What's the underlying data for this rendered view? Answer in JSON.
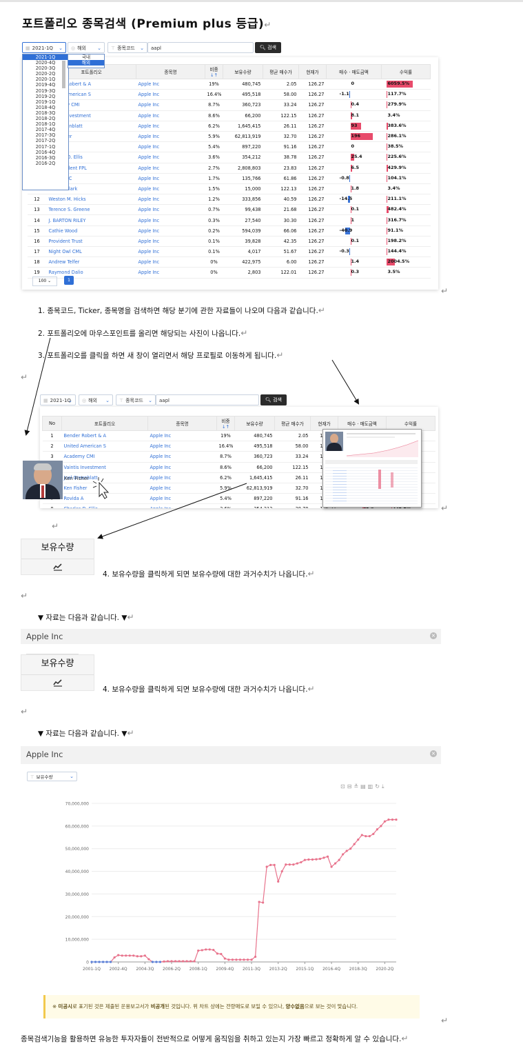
{
  "title": "포트폴리오 종목검색 (Premium plus 등급)",
  "return_mark": "↵",
  "filters": {
    "quarter": "2021-1Q",
    "region": "해외",
    "field": "종목코드",
    "query": "aapl",
    "search_label": "검색"
  },
  "quarter_options": [
    "2021-1Q",
    "2020-4Q",
    "2020-3Q",
    "2020-2Q",
    "2020-1Q",
    "2019-4Q",
    "2019-3Q",
    "2019-2Q",
    "2019-1Q",
    "2018-4Q",
    "2018-3Q",
    "2018-2Q",
    "2018-1Q",
    "2017-4Q",
    "2017-3Q",
    "2017-2Q",
    "2017-1Q",
    "2016-4Q",
    "2016-3Q",
    "2016-2Q"
  ],
  "region_options": [
    "국내",
    "해외"
  ],
  "table": {
    "headers": [
      "No",
      "포트폴리오",
      "종목명",
      "비중",
      "보유수량",
      "평균 매수가",
      "현재가",
      "매수 · 매도금액",
      "수익률"
    ],
    "header_sort_icon": "↓↑",
    "rows": [
      {
        "no": "1",
        "portfolio": "Bender Robert & A",
        "stock": "Apple Inc",
        "weight": "19%",
        "qty": "480,745",
        "avg": "2.05",
        "price": "126.27",
        "trade": "0",
        "ret": "6059.5%"
      },
      {
        "no": "2",
        "portfolio": "United American S",
        "stock": "Apple Inc",
        "weight": "16.4%",
        "qty": "495,518",
        "avg": "58.00",
        "price": "126.27",
        "trade": "-1.1",
        "ret": "117.7%"
      },
      {
        "no": "3",
        "portfolio": "Academy CMI",
        "stock": "Apple Inc",
        "weight": "8.7%",
        "qty": "360,723",
        "avg": "33.24",
        "price": "126.27",
        "trade": "0.4",
        "ret": "279.9%"
      },
      {
        "no": "4",
        "portfolio": "Vaintis Investment",
        "stock": "Apple Inc",
        "weight": "8.6%",
        "qty": "66,200",
        "avg": "122.15",
        "price": "126.27",
        "trade": "8.1",
        "ret": "3.4%"
      },
      {
        "no": "5",
        "portfolio": "Joel Greenblatt",
        "stock": "Apple Inc",
        "weight": "6.2%",
        "qty": "1,645,415",
        "avg": "26.11",
        "price": "126.27",
        "trade": "93",
        "ret": "383.6%"
      },
      {
        "no": "6",
        "portfolio": "Ken Fisher",
        "stock": "Apple Inc",
        "weight": "5.9%",
        "qty": "62,813,919",
        "avg": "32.70",
        "price": "126.27",
        "trade": "196",
        "ret": "286.1%"
      },
      {
        "no": "7",
        "portfolio": "Rovida A",
        "stock": "Apple Inc",
        "weight": "5.4%",
        "qty": "897,220",
        "avg": "91.16",
        "price": "126.27",
        "trade": "0",
        "ret": "38.5%"
      },
      {
        "no": "8",
        "portfolio": "Charles D. Ellis",
        "stock": "Apple Inc",
        "weight": "3.6%",
        "qty": "354,212",
        "avg": "38.78",
        "price": "126.27",
        "trade": "25.4",
        "ret": "225.6%"
      },
      {
        "no": "9",
        "portfolio": "Independent FPL",
        "stock": "Apple Inc",
        "weight": "2.7%",
        "qty": "2,808,803",
        "avg": "23.83",
        "price": "126.27",
        "trade": "6.5",
        "ret": "429.9%"
      },
      {
        "no": "10",
        "portfolio": "Horst FMC",
        "stock": "Apple Inc",
        "weight": "1.7%",
        "qty": "135,766",
        "avg": "61.86",
        "price": "126.27",
        "trade": "-0.8",
        "ret": "104.1%"
      },
      {
        "no": "11",
        "portfolio": "Willard Clark",
        "stock": "Apple Inc",
        "weight": "1.5%",
        "qty": "15,000",
        "avg": "122.13",
        "price": "126.27",
        "trade": "1.8",
        "ret": "3.4%"
      },
      {
        "no": "12",
        "portfolio": "Weston M. Hicks",
        "stock": "Apple Inc",
        "weight": "1.2%",
        "qty": "333,856",
        "avg": "40.59",
        "price": "126.27",
        "trade": "-14.5",
        "ret": "211.1%"
      },
      {
        "no": "13",
        "portfolio": "Terence S. Greene",
        "stock": "Apple Inc",
        "weight": "0.7%",
        "qty": "99,438",
        "avg": "21.68",
        "price": "126.27",
        "trade": "0.1",
        "ret": "482.4%"
      },
      {
        "no": "14",
        "portfolio": "J. BARTON RILEY",
        "stock": "Apple Inc",
        "weight": "0.3%",
        "qty": "27,540",
        "avg": "30.30",
        "price": "126.27",
        "trade": "1",
        "ret": "316.7%"
      },
      {
        "no": "15",
        "portfolio": "Cathie Wood",
        "stock": "Apple Inc",
        "weight": "0.2%",
        "qty": "594,039",
        "avg": "66.06",
        "price": "126.27",
        "trade": "-40.9",
        "ret": "91.1%"
      },
      {
        "no": "16",
        "portfolio": "Provident Trust",
        "stock": "Apple Inc",
        "weight": "0.1%",
        "qty": "39,828",
        "avg": "42.35",
        "price": "126.27",
        "trade": "0.1",
        "ret": "198.2%"
      },
      {
        "no": "17",
        "portfolio": "Night Owl CML",
        "stock": "Apple Inc",
        "weight": "0.1%",
        "qty": "4,017",
        "avg": "51.67",
        "price": "126.27",
        "trade": "-0.3",
        "ret": "144.4%"
      },
      {
        "no": "18",
        "portfolio": "Andrew Telfer",
        "stock": "Apple Inc",
        "weight": "0%",
        "qty": "422,975",
        "avg": "6.00",
        "price": "126.27",
        "trade": "1.4",
        "ret": "2004.5%"
      },
      {
        "no": "19",
        "portfolio": "Raymond Dalio",
        "stock": "Apple Inc",
        "weight": "0%",
        "qty": "2,803",
        "avg": "122.01",
        "price": "126.27",
        "trade": "0.3",
        "ret": "3.5%"
      }
    ]
  },
  "pagination": {
    "page_size": "100",
    "current_page": "1"
  },
  "steps": [
    "1.  종목코드, Ticker, 종목명을 검색하면 해당 분기에 관한 자료들이 나오며 다음과 같습니다.",
    "2.  포트폴리오에 마우스포인트를 올리면 해당되는 사진이 나옵니다.",
    "3.  포트폴리오를 클릭을 하면 새 창이 열리면서 해당 프로필로 이동하게 됩니다.",
    "4. 보유수량을 클릭하게 되면 보유수량에 대한 과거수치가 나옵니다."
  ],
  "hover_name": "Ken Fisher",
  "qty_header_label": "보유수량",
  "data_intro": "▼  자료는 다음과 같습니다. ▼",
  "modal": {
    "title": "Apple Inc",
    "metric": "보유수량"
  },
  "chart_data": {
    "type": "line",
    "title": "",
    "xlabel": "",
    "ylabel": "",
    "ylim": [
      0,
      70000000
    ],
    "yticks": [
      "0",
      "10,000,000",
      "20,000,000",
      "30,000,000",
      "40,000,000",
      "50,000,000",
      "60,000,000",
      "70,000,000"
    ],
    "xticks": [
      "2001-1Q",
      "2002-4Q",
      "2004-3Q",
      "2006-2Q",
      "2008-1Q",
      "2009-4Q",
      "2011-3Q",
      "2013-2Q",
      "2015-1Q",
      "2016-4Q",
      "2018-3Q",
      "2020-2Q"
    ],
    "line_color": "#e8738c",
    "zero_color": "#5b7fd6",
    "x": [
      "2001-1Q",
      "2001-2Q",
      "2001-3Q",
      "2001-4Q",
      "2002-1Q",
      "2002-2Q",
      "2002-3Q",
      "2002-4Q",
      "2003-1Q",
      "2003-2Q",
      "2003-3Q",
      "2003-4Q",
      "2004-1Q",
      "2004-2Q",
      "2004-3Q",
      "2004-4Q",
      "2005-1Q",
      "2005-2Q",
      "2005-3Q",
      "2005-4Q",
      "2006-1Q",
      "2006-2Q",
      "2006-3Q",
      "2006-4Q",
      "2007-1Q",
      "2007-2Q",
      "2007-3Q",
      "2007-4Q",
      "2008-1Q",
      "2008-2Q",
      "2008-3Q",
      "2008-4Q",
      "2009-1Q",
      "2009-2Q",
      "2009-3Q",
      "2009-4Q",
      "2010-1Q",
      "2010-2Q",
      "2010-3Q",
      "2010-4Q",
      "2011-1Q",
      "2011-2Q",
      "2011-3Q",
      "2011-4Q",
      "2012-1Q",
      "2012-2Q",
      "2012-3Q",
      "2012-4Q",
      "2013-1Q",
      "2013-2Q",
      "2013-3Q",
      "2013-4Q",
      "2014-1Q",
      "2014-2Q",
      "2014-3Q",
      "2014-4Q",
      "2015-1Q",
      "2015-2Q",
      "2015-3Q",
      "2015-4Q",
      "2016-1Q",
      "2016-2Q",
      "2016-3Q",
      "2016-4Q",
      "2017-1Q",
      "2017-2Q",
      "2017-3Q",
      "2017-4Q",
      "2018-1Q",
      "2018-2Q",
      "2018-3Q",
      "2018-4Q",
      "2019-1Q",
      "2019-2Q",
      "2019-3Q",
      "2019-4Q",
      "2020-1Q",
      "2020-2Q",
      "2020-3Q",
      "2020-4Q",
      "2021-1Q"
    ],
    "values": [
      0,
      0,
      0,
      0,
      0,
      0,
      2000000,
      3000000,
      2800000,
      2800000,
      2800000,
      2800000,
      2500000,
      2500000,
      2800000,
      1200000,
      0,
      0,
      0,
      200000,
      300000,
      300000,
      300000,
      300000,
      300000,
      300000,
      300000,
      300000,
      5000000,
      5200000,
      5500000,
      5500000,
      5300000,
      3700000,
      3500000,
      1500000,
      1000000,
      1000000,
      1000000,
      1000000,
      1000000,
      1000000,
      1000000,
      2300000,
      26500000,
      26200000,
      42000000,
      42800000,
      42800000,
      35500000,
      40000000,
      43000000,
      43000000,
      43000000,
      43500000,
      44000000,
      45000000,
      45200000,
      45200000,
      45300000,
      45500000,
      46000000,
      46500000,
      42000000,
      43500000,
      45000000,
      47500000,
      49000000,
      50000000,
      52000000,
      54000000,
      56000000,
      55500000,
      55500000,
      56500000,
      58500000,
      60000000,
      62000000,
      62800000,
      62813919,
      62813919
    ]
  },
  "note_parts": [
    "※ ",
    "미공시",
    "로 표기된 것은 제출된 운용보고서가 ",
    "비공개",
    "된 것입니다. 위 차트 상에는 전량매도로 보일 수 있으나, ",
    "양수없음",
    "으로 보는 것이 맞습니다."
  ],
  "conclusion": "종목검색기능을 활용하면 유능한 투자자들이 전반적으로 어떻게 움직임을 취하고 있는지 가장 빠르고 정확하게 알 수 있습니다."
}
